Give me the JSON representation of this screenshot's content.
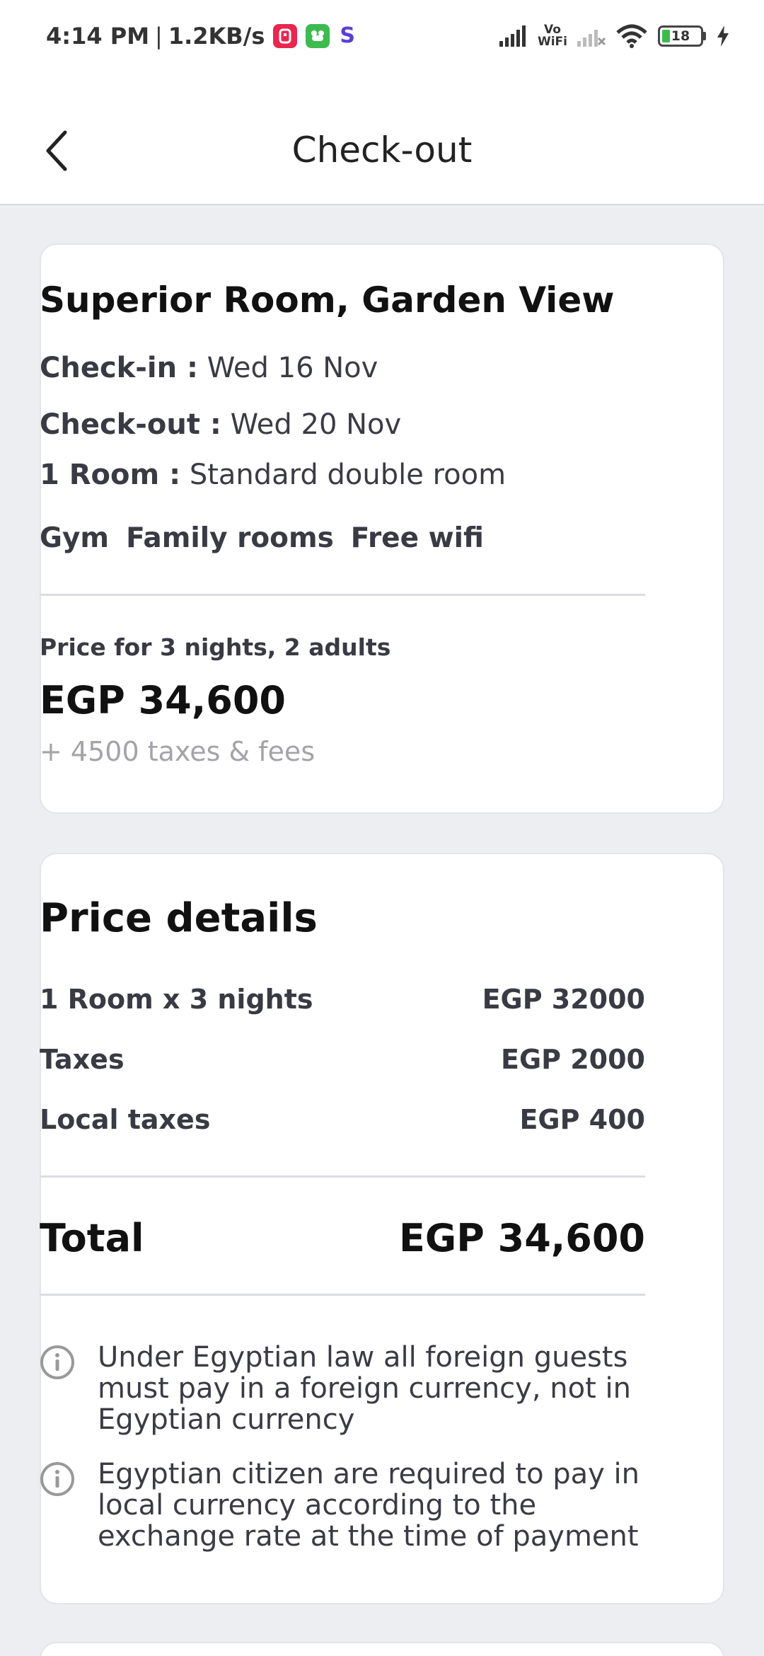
{
  "status": {
    "time": "4:14 PM",
    "speed": "1.2KB/s",
    "vowifi_top": "Vo",
    "vowifi_bottom": "WiFi",
    "battery": "18"
  },
  "header": {
    "title": "Check-out"
  },
  "booking": {
    "room_title": "Superior Room, Garden View",
    "check_in_label": "Check-in :",
    "check_in_value": "Wed 16 Nov",
    "check_out_label": "Check-out :",
    "check_out_value": "Wed 20 Nov",
    "rooms_label": "1 Room :",
    "rooms_value": "Standard double room",
    "amenities": [
      "Gym",
      "Family rooms",
      "Free wifi"
    ],
    "price_for": "Price for 3 nights, 2 adults",
    "price": "EGP 34,600",
    "taxes_note": "+ 4500 taxes & fees"
  },
  "price_details": {
    "title": "Price details",
    "rows": [
      {
        "label": "1 Room x 3 nights",
        "value": "EGP 32000"
      },
      {
        "label": "Taxes",
        "value": "EGP 2000"
      },
      {
        "label": "Local taxes",
        "value": "EGP 400"
      }
    ],
    "total_label": "Total",
    "total_value": "EGP 34,600",
    "notes": [
      "Under Egyptian law all foreign guests must pay in a foreign currency, not in Egyptian currency",
      "Egyptian citizen are required to pay in local currency according to the exchange rate at the time of payment"
    ]
  },
  "colors": {
    "background": "#edeef2",
    "card": "#ffffff",
    "text_primary": "#111111",
    "text_secondary": "#3a3a44",
    "text_muted": "#a3a3a8"
  }
}
